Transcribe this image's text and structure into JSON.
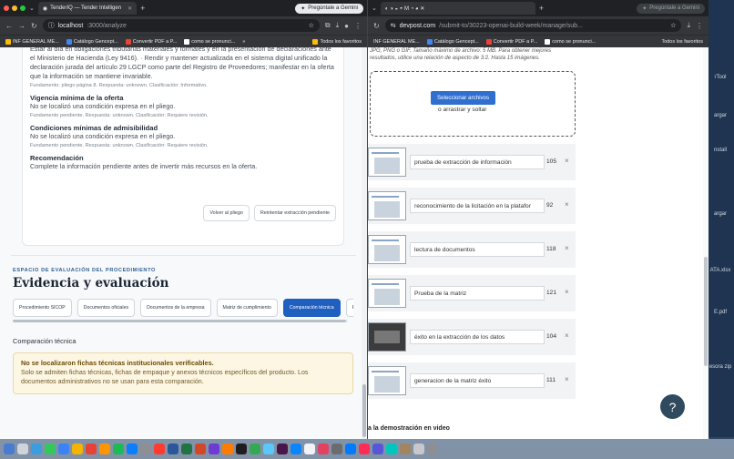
{
  "left_window": {
    "tab_title": "TenderIQ — Tender Intelligen",
    "gemini_label": "Pregúntale a Gemini",
    "url_host": "localhost",
    "url_path": ":3000/analyze",
    "bookmarks": [
      "INF GENERAL ME...",
      "Catálogo Gencept...",
      "Convertir PDF a P...",
      "como se pronunci..."
    ],
    "bookmarks_more": "»",
    "all_bookmarks": "Todos los favoritos",
    "card": {
      "intro_text": "Estar al día en obligaciones tributarias materiales y formales y en la presentación de declaraciones ante el Ministerio de Hacienda (Ley 9416). · Rendir y mantener actualizada en el sistema digital unificado la declaración jurada del artículo 29 LGCP como parte del Registro de Proveedores; manifestar en la oferta que la información se mantiene invariable.",
      "intro_meta": "Fundamento: pliego página 8. Respuesta: unknown. Clasificación: Informativo.",
      "sections": [
        {
          "title": "Vigencia mínima de la oferta",
          "text": "No se localizó una condición expresa en el pliego.",
          "meta": "Fundamento pendiente. Respuesta: unknown. Clasificación: Requiere revisión."
        },
        {
          "title": "Condiciones mínimas de admisibilidad",
          "text": "No se localizó una condición expresa en el pliego.",
          "meta": "Fundamento pendiente. Respuesta: unknown. Clasificación: Requiere revisión."
        },
        {
          "title": "Recomendación",
          "text": "Complete la información pendiente antes de invertir más recursos en la oferta.",
          "meta": ""
        }
      ],
      "btn_back": "Volver al pliego",
      "btn_retry": "Reintentar extracción pendiente"
    },
    "eyebrow": "ESPACIO DE EVALUACIÓN DEL PROCEDIMIENTO",
    "heading": "Evidencia y evaluación",
    "tabs": [
      "Procedimiento SICOP",
      "Documentos oficiales",
      "Documentos de la empresa",
      "Matriz de cumplimiento",
      "Comparación técnica",
      "Recomendación"
    ],
    "active_tab": "Comparación técnica",
    "subheading": "Comparación técnica",
    "alert_title": "No se localizaron fichas técnicas institucionales verificables.",
    "alert_body": "Solo se admiten fichas técnicas, fichas de empaque y anexos técnicos específicos del producto. Los documentos administrativos no se usan para esta comparación."
  },
  "right_window": {
    "gemini_label": "Pregúntale a Gemini",
    "url_host": "devpost.com",
    "url_path": "/submit-to/30223-openai-build-week/manage/sub...",
    "bookmarks": [
      "INF GENERAL ME...",
      "Catálogo Gencept...",
      "Convertir PDF a P...",
      "como se pronunci..."
    ],
    "all_bookmarks": "Todos los favoritos",
    "hint": "JPG, PNG o GIF. Tamaño máximo de archivo: 5 MB. Para obtener mejores resultados, utilice una relación de aspecto de 3:2. Hasta 15 imágenes.",
    "select_button": "Seleccionar archivos",
    "drag_text": "o arrastrar y soltar",
    "items": [
      {
        "caption": "prueba de extracción de información",
        "count": "105"
      },
      {
        "caption": "reconocimiento de la licitación en la platafor",
        "count": "92"
      },
      {
        "caption": "lectura de documentos",
        "count": "118"
      },
      {
        "caption": "Prueba de la matriz",
        "count": "121"
      },
      {
        "caption": "éxito en la extracción de los datos",
        "count": "104"
      },
      {
        "caption": "generacion de la matriz éxito",
        "count": "111"
      }
    ],
    "remove_glyph": "×",
    "help_glyph": "?",
    "bottom_text": "a la demostración en video"
  },
  "desktop_labels": [
    "rTool",
    "argar",
    "nstall",
    "argar",
    "ATA.xlsx",
    "E.pdf",
    "esora zip"
  ],
  "colors": {
    "accent": "#1f5fbf",
    "alert_bg": "#fdf6e3",
    "select_btn": "#2f6fd0",
    "help_bg": "#2f4a5e"
  }
}
